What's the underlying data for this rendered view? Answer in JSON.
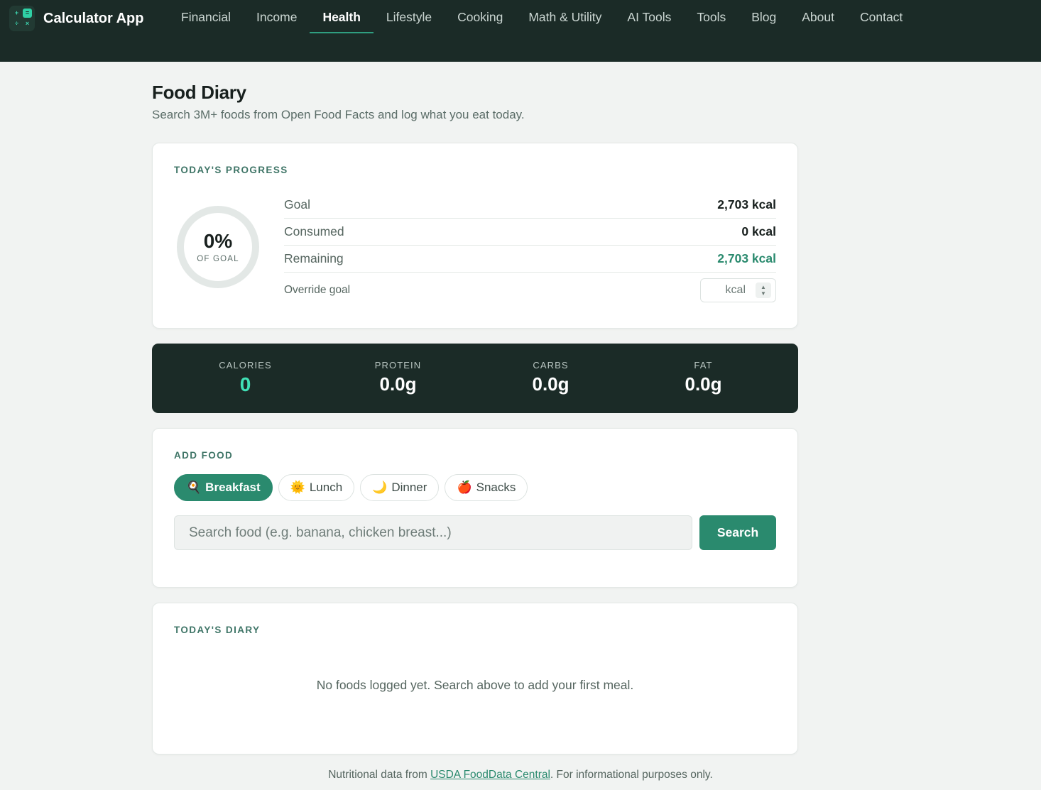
{
  "app": {
    "name": "Calculator App",
    "logo_glyphs": [
      "+",
      "=",
      "÷",
      "×"
    ]
  },
  "nav": {
    "items": [
      {
        "label": "Financial"
      },
      {
        "label": "Income"
      },
      {
        "label": "Health",
        "active": true
      },
      {
        "label": "Lifestyle"
      },
      {
        "label": "Cooking"
      },
      {
        "label": "Math & Utility"
      },
      {
        "label": "AI Tools"
      },
      {
        "label": "Tools"
      },
      {
        "label": "Blog"
      },
      {
        "label": "About"
      },
      {
        "label": "Contact"
      }
    ]
  },
  "page": {
    "title": "Food Diary",
    "subtitle": "Search 3M+ foods from Open Food Facts and log what you eat today."
  },
  "progress": {
    "section_label": "Today's Progress",
    "percent_text": "0%",
    "percent_value": 0,
    "percent_sub": "OF GOAL",
    "goal_label": "Goal",
    "goal_value": "2,703 kcal",
    "consumed_label": "Consumed",
    "consumed_value": "0 kcal",
    "remaining_label": "Remaining",
    "remaining_value": "2,703 kcal",
    "override_label": "Override goal",
    "override_placeholder": "kcal"
  },
  "macros": {
    "calories_label": "CALORIES",
    "calories_value": "0",
    "protein_label": "PROTEIN",
    "protein_value": "0.0g",
    "carbs_label": "CARBS",
    "carbs_value": "0.0g",
    "fat_label": "FAT",
    "fat_value": "0.0g"
  },
  "add_food": {
    "section_label": "Add Food",
    "meals": [
      {
        "label": "Breakfast",
        "icon": "🍳",
        "active": true
      },
      {
        "label": "Lunch",
        "icon": "🌞"
      },
      {
        "label": "Dinner",
        "icon": "🌙"
      },
      {
        "label": "Snacks",
        "icon": "🍎"
      }
    ],
    "search_placeholder": "Search food (e.g. banana, chicken breast...)",
    "search_button": "Search"
  },
  "diary": {
    "section_label": "Today's Diary",
    "empty_message": "No foods logged yet. Search above to add your first meal."
  },
  "footer": {
    "prefix": "Nutritional data from ",
    "link_text": "USDA FoodData Central",
    "suffix": ". For informational purposes only."
  },
  "colors": {
    "header_bg": "#1b2b27",
    "accent": "#2a8a6e",
    "calories_accent": "#40e0b5",
    "page_bg": "#f1f3f2"
  }
}
